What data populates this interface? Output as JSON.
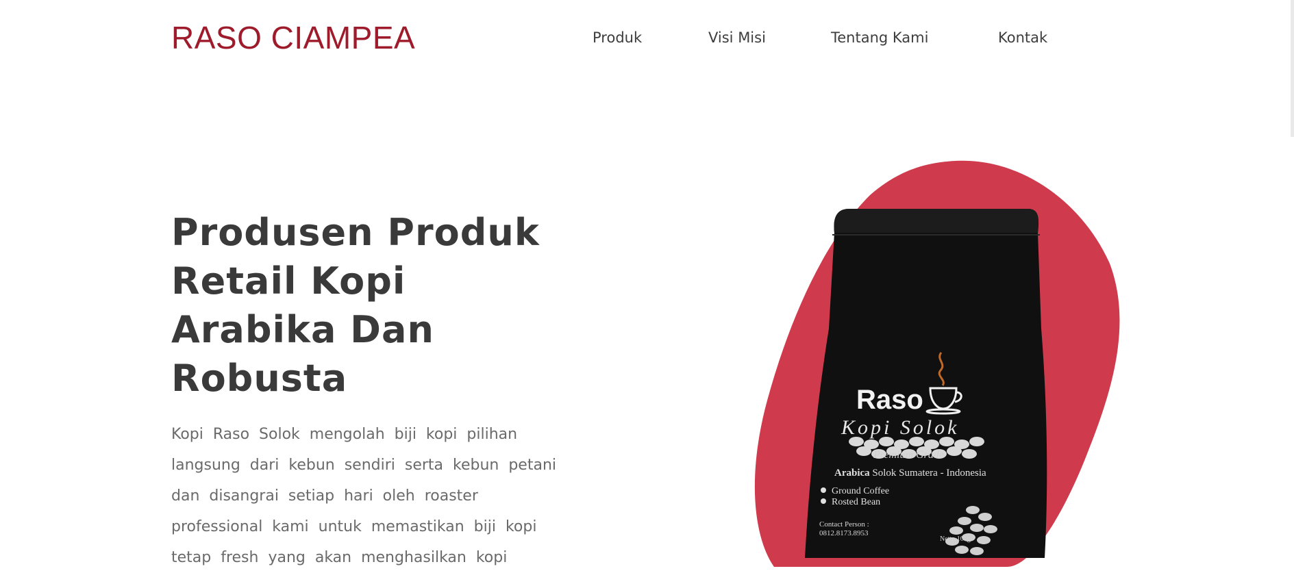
{
  "header": {
    "brand": "RASO CIAMPEA",
    "nav": [
      {
        "label": "Produk"
      },
      {
        "label": "Visi Misi"
      },
      {
        "label": "Tentang Kami"
      },
      {
        "label": "Kontak"
      }
    ]
  },
  "hero": {
    "title_lines": [
      "Produsen Produk",
      "Retail Kopi",
      "Arabika Dan",
      "Robusta"
    ],
    "description_lines": [
      "Kopi  Raso  Solok  mengolah  biji  kopi  pilihan",
      "langsung  dari  kebun  sendiri  serta  kebun  petani",
      "dan  disangrai  setiap  hari  oleh  roaster",
      "professional  kami  untuk  memastikan  biji  kopi",
      "tetap  fresh  yang  akan  menghasilkan  kopi"
    ]
  },
  "product_bag": {
    "brand": "Raso",
    "subtitle": "Kopi Solok",
    "grade": "Premium Grade",
    "origin_bold": "Arabica",
    "origin_rest": " Solok Sumatera - Indonesia",
    "options": [
      "Ground Coffee",
      "Rosted Bean"
    ],
    "contact_label": "Contact Person :",
    "contact_number": "0812.8173.8953",
    "netto": "Netto 100gr"
  },
  "colors": {
    "brand": "#9e1b2c",
    "blob": "#cf3a4c",
    "bag": "#111111",
    "heading": "#3a3a3a",
    "body_text": "#6a6a6a"
  }
}
